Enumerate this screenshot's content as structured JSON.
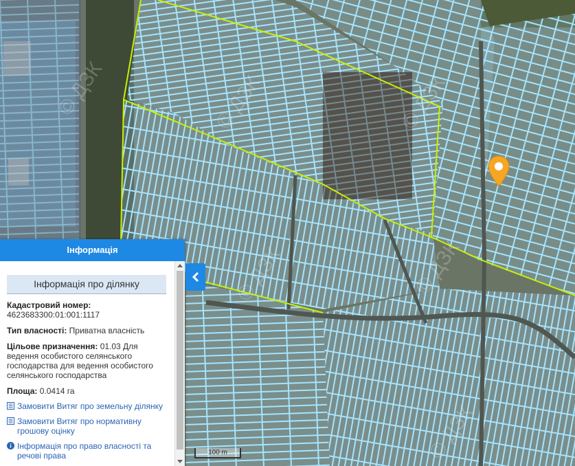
{
  "map": {
    "watermark": "© ДЗК",
    "scale_label": "100 m",
    "parcel_outline_color": "#9fe2ff",
    "boundary_color": "#c8f000",
    "marker_color": "#f5a623",
    "marker_icon": "location-pin-icon"
  },
  "panel": {
    "header": "Інформація",
    "section_title": "Інформація про ділянку",
    "cadastral_label": "Кадастровий номер:",
    "cadastral_value": "4623683300:01:001:1117",
    "ownership_label": "Тип власності:",
    "ownership_value": "Приватна власність",
    "purpose_label": "Цільове призначення:",
    "purpose_value": "01.03 Для ведення особистого селянського господарства для ведення особистого селянського господарства",
    "area_label": "Площа:",
    "area_value": "0.0414 га",
    "links": [
      {
        "label": "Замовити Витяг про земельну ділянку",
        "icon": "document-list-icon"
      },
      {
        "label": "Замовити Витяг про нормативну грошову оцінку",
        "icon": "document-list-icon"
      },
      {
        "label": "Інформація про право власності та речові права",
        "icon": "info-circle-icon"
      }
    ],
    "collapse_icon": "chevron-left-icon"
  }
}
